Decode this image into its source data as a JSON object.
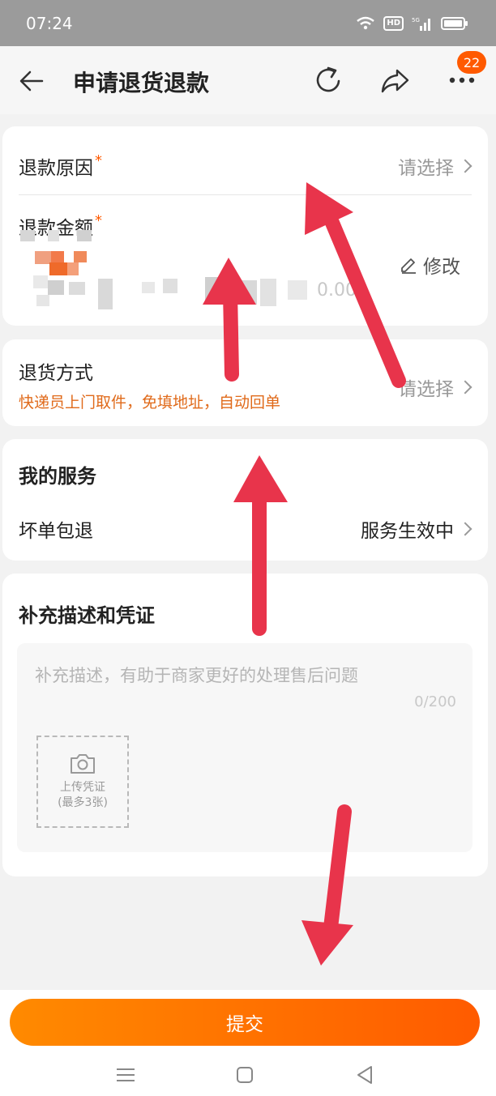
{
  "status_bar": {
    "time": "07:24",
    "hd": "HD",
    "network": "5G"
  },
  "header": {
    "title": "申请退货退款",
    "badge_count": "22"
  },
  "refund_card": {
    "reason_label": "退款原因",
    "reason_value": "请选择",
    "amount_label": "退款金额",
    "amount_value": "0.00",
    "edit_label": "修改"
  },
  "return_card": {
    "method_label": "退货方式",
    "method_value": "请选择",
    "method_hint": "快递员上门取件，免填地址，自动回单"
  },
  "service_card": {
    "title": "我的服务",
    "item_label": "坏单包退",
    "item_value": "服务生效中"
  },
  "desc_card": {
    "title": "补充描述和凭证",
    "placeholder": "补充描述，有助于商家更好的处理售后问题",
    "counter": "0/200",
    "upload_line1": "上传凭证",
    "upload_line2": "(最多3张)"
  },
  "footer": {
    "submit_label": "提交"
  },
  "colors": {
    "accent": "#ff5a00",
    "annotation_arrow": "#e8344b"
  },
  "icons": [
    "back-arrow-icon",
    "refresh-icon",
    "share-icon",
    "more-icon",
    "chevron-right-icon",
    "edit-icon",
    "camera-icon",
    "menu-icon",
    "home-icon",
    "back-triangle-icon"
  ]
}
